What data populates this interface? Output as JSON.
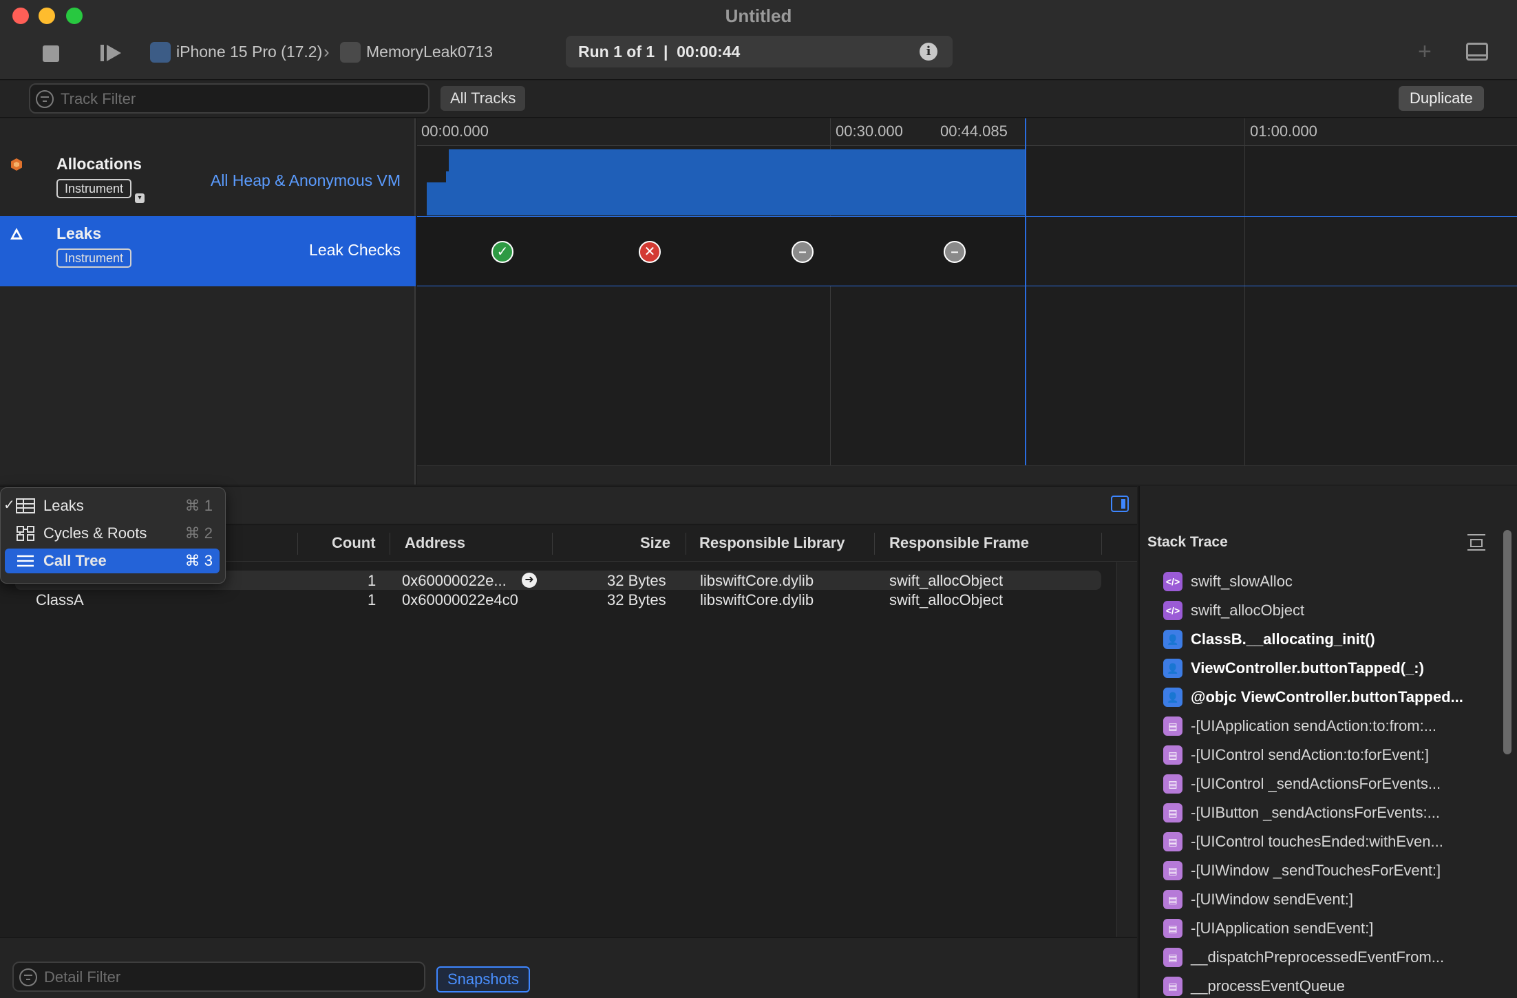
{
  "window": {
    "title": "Untitled",
    "traffic_lights": [
      "#ff5f57",
      "#febc2e",
      "#28c840"
    ]
  },
  "toolbar": {
    "device": "iPhone 15 Pro (17.2)",
    "app": "MemoryLeak0713",
    "run_status": "Run 1 of 1  |  00:00:44",
    "info_glyph": "i"
  },
  "filter_bar": {
    "track_filter_placeholder": "Track Filter",
    "all_tracks": "All Tracks",
    "duplicate": "Duplicate"
  },
  "ruler": {
    "ticks": [
      "00:00.000",
      "00:30.000",
      "00:44.085",
      "01:00.000"
    ]
  },
  "tracks": [
    {
      "name": "Allocations",
      "tag": "Instrument",
      "detail": "All Heap & Anonymous VM",
      "color": "#1f5fb8"
    },
    {
      "name": "Leaks",
      "tag": "Instrument",
      "detail": "Leak Checks",
      "color": "#1f5fd6"
    }
  ],
  "leak_checks": [
    {
      "status": "ok",
      "glyph": "✓",
      "color": "#2e9a44"
    },
    {
      "status": "leak",
      "glyph": "✕",
      "color": "#d33a33"
    },
    {
      "status": "none",
      "glyph": "–",
      "color": "#8a8a8a"
    },
    {
      "status": "none",
      "glyph": "–",
      "color": "#8a8a8a"
    }
  ],
  "detail_menu": [
    {
      "label": "Leaks",
      "shortcut": "⌘ 1",
      "checked": true,
      "icon": "table-icon"
    },
    {
      "label": "Cycles & Roots",
      "shortcut": "⌘ 2",
      "checked": false,
      "icon": "graph-icon"
    },
    {
      "label": "Call Tree",
      "shortcut": "⌘ 3",
      "checked": false,
      "icon": "list-icon"
    }
  ],
  "table": {
    "columns": [
      "Count",
      "Address",
      "Size",
      "Responsible Library",
      "Responsible Frame"
    ],
    "rows": [
      {
        "type": "",
        "count": "1",
        "address": "0x60000022e...",
        "size": "32 Bytes",
        "library": "libswiftCore.dylib",
        "frame": "swift_allocObject"
      },
      {
        "type": "ClassA",
        "count": "1",
        "address": "0x60000022e4c0",
        "size": "32 Bytes",
        "library": "libswiftCore.dylib",
        "frame": "swift_allocObject"
      }
    ]
  },
  "bottom_bar": {
    "detail_filter_placeholder": "Detail Filter",
    "snapshots": "Snapshots"
  },
  "stack_trace": {
    "title": "Stack Trace",
    "frames": [
      {
        "text": "swift_slowAlloc",
        "kind": "system",
        "glyph": "</>"
      },
      {
        "text": "swift_allocObject",
        "kind": "system",
        "glyph": "</>"
      },
      {
        "text": "ClassB.__allocating_init()",
        "kind": "user",
        "glyph": "👤"
      },
      {
        "text": "ViewController.buttonTapped(_:)",
        "kind": "user",
        "glyph": "👤"
      },
      {
        "text": "@objc ViewController.buttonTapped...",
        "kind": "user",
        "glyph": "👤"
      },
      {
        "text": "-[UIApplication sendAction:to:from:...",
        "kind": "framework",
        "glyph": "▤"
      },
      {
        "text": "-[UIControl sendAction:to:forEvent:]",
        "kind": "framework",
        "glyph": "▤"
      },
      {
        "text": "-[UIControl _sendActionsForEvents...",
        "kind": "framework",
        "glyph": "▤"
      },
      {
        "text": "-[UIButton _sendActionsForEvents:...",
        "kind": "framework",
        "glyph": "▤"
      },
      {
        "text": "-[UIControl touchesEnded:withEven...",
        "kind": "framework",
        "glyph": "▤"
      },
      {
        "text": "-[UIWindow _sendTouchesForEvent:]",
        "kind": "framework",
        "glyph": "▤"
      },
      {
        "text": "-[UIWindow sendEvent:]",
        "kind": "framework",
        "glyph": "▤"
      },
      {
        "text": "-[UIApplication sendEvent:]",
        "kind": "framework",
        "glyph": "▤"
      },
      {
        "text": "__dispatchPreprocessedEventFrom...",
        "kind": "framework",
        "glyph": "▤"
      },
      {
        "text": "__processEventQueue",
        "kind": "framework",
        "glyph": "▤"
      }
    ],
    "colors": {
      "system": "#9b5bd6",
      "user": "#3d7de6",
      "framework": "#b67ad8"
    }
  }
}
